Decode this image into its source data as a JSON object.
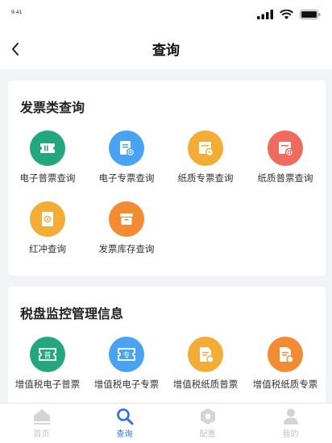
{
  "status_bar": {
    "time": "9:41"
  },
  "nav": {
    "title": "查询"
  },
  "colors": {
    "green": "#24a77f",
    "blue": "#4aa3f0",
    "orange": "#f3ad37",
    "red": "#f06a60",
    "tab_active": "#2d6fe3",
    "tab_inactive": "#c4c4c4"
  },
  "section1": {
    "title": "发票类查询",
    "items": [
      {
        "label": "电子普票查询",
        "icon": "ticket-icon"
      },
      {
        "label": "电子专票查询",
        "icon": "document-search-icon"
      },
      {
        "label": "纸质专票查询",
        "icon": "paper-special-icon"
      },
      {
        "label": "纸质普票查询",
        "icon": "paper-general-icon"
      },
      {
        "label": "红冲查询",
        "icon": "red-reversal-icon"
      },
      {
        "label": "发票库存查询",
        "icon": "inventory-box-icon"
      }
    ]
  },
  "section2": {
    "title": "税盘监控管理信息",
    "items": [
      {
        "label": "增值税电子普票",
        "icon": "vat-electronic-general-icon",
        "badge": "普"
      },
      {
        "label": "增值税电子专票",
        "icon": "vat-electronic-special-icon",
        "badge": "专"
      },
      {
        "label": "增值税纸质普票",
        "icon": "vat-paper-general-icon"
      },
      {
        "label": "增值税纸质专票",
        "icon": "vat-paper-special-icon"
      }
    ]
  },
  "tabs": [
    {
      "label": "首页",
      "icon": "home-icon",
      "active": false
    },
    {
      "label": "查询",
      "icon": "search-icon",
      "active": true
    },
    {
      "label": "配置",
      "icon": "settings-icon",
      "active": false
    },
    {
      "label": "我的",
      "icon": "user-icon",
      "active": false
    }
  ]
}
